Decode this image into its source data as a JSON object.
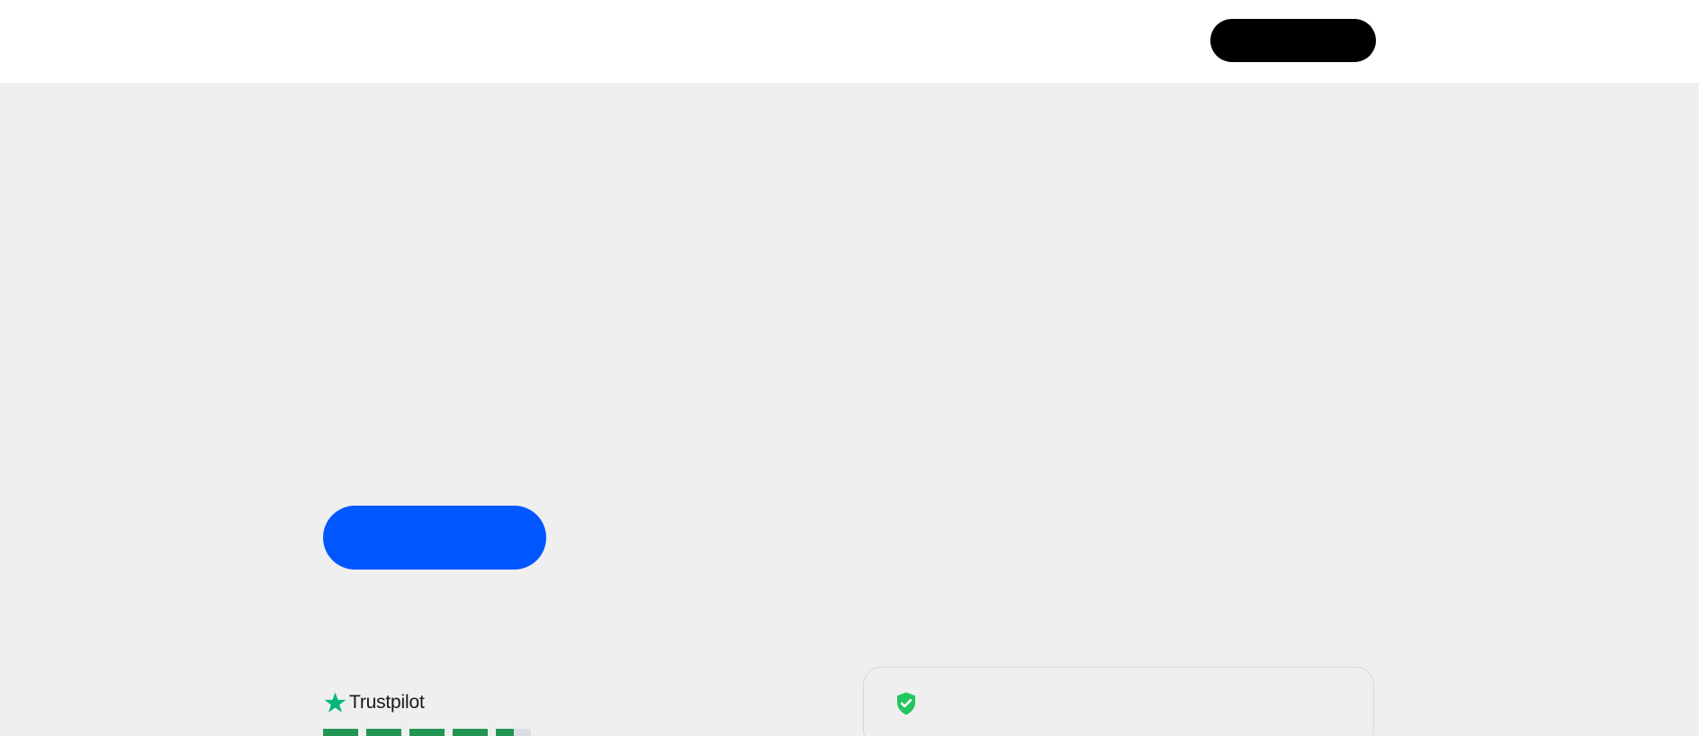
{
  "colors": {
    "page_background": "#efefef",
    "header_background": "#ffffff",
    "header_button": "#000000",
    "primary_button": "#0057ff",
    "trustpilot_green": "#00b67a",
    "rating_green": "#219653",
    "rating_empty": "#dcdce6",
    "shield_green": "#22c55e",
    "card_border": "#d8d8d8"
  },
  "header": {
    "button": {
      "icon": "none",
      "label": ""
    }
  },
  "hero": {
    "primary_button": {
      "label": ""
    }
  },
  "trustpilot": {
    "brand": "Trustpilot",
    "logo_icon": "star-icon",
    "rating": {
      "value": 4.5,
      "max": 5,
      "box_fills": [
        1,
        1,
        1,
        1,
        0.5
      ]
    }
  },
  "security_card": {
    "icon": "shield-check-icon"
  }
}
